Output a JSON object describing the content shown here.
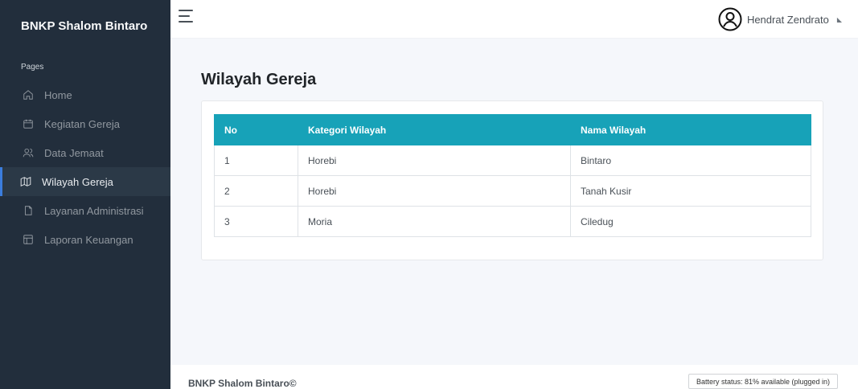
{
  "sidebar": {
    "brand": "BNKP Shalom Bintaro",
    "section": "Pages",
    "items": [
      {
        "label": "Home",
        "icon": "home-icon",
        "active": false
      },
      {
        "label": "Kegiatan Gereja",
        "icon": "calendar-icon",
        "active": false
      },
      {
        "label": "Data Jemaat",
        "icon": "users-icon",
        "active": false
      },
      {
        "label": "Wilayah Gereja",
        "icon": "map-icon",
        "active": true
      },
      {
        "label": "Layanan Administrasi",
        "icon": "file-icon",
        "active": false
      },
      {
        "label": "Laporan Keuangan",
        "icon": "layout-icon",
        "active": false
      }
    ]
  },
  "topbar": {
    "user_name": "Hendrat Zendrato"
  },
  "main": {
    "title": "Wilayah Gereja",
    "table": {
      "headers": [
        "No",
        "Kategori Wilayah",
        "Nama Wilayah"
      ],
      "rows": [
        [
          "1",
          "Horebi",
          "Bintaro"
        ],
        [
          "2",
          "Horebi",
          "Tanah Kusir"
        ],
        [
          "3",
          "Moria",
          "Ciledug"
        ]
      ]
    }
  },
  "footer": {
    "text": "BNKP Shalom Bintaro©"
  },
  "battery": {
    "text": "Battery status: 81% available (plugged in)"
  },
  "colors": {
    "sidebar": "#222e3c",
    "header": "#17a2b8",
    "active_accent": "#3b7ddd"
  }
}
